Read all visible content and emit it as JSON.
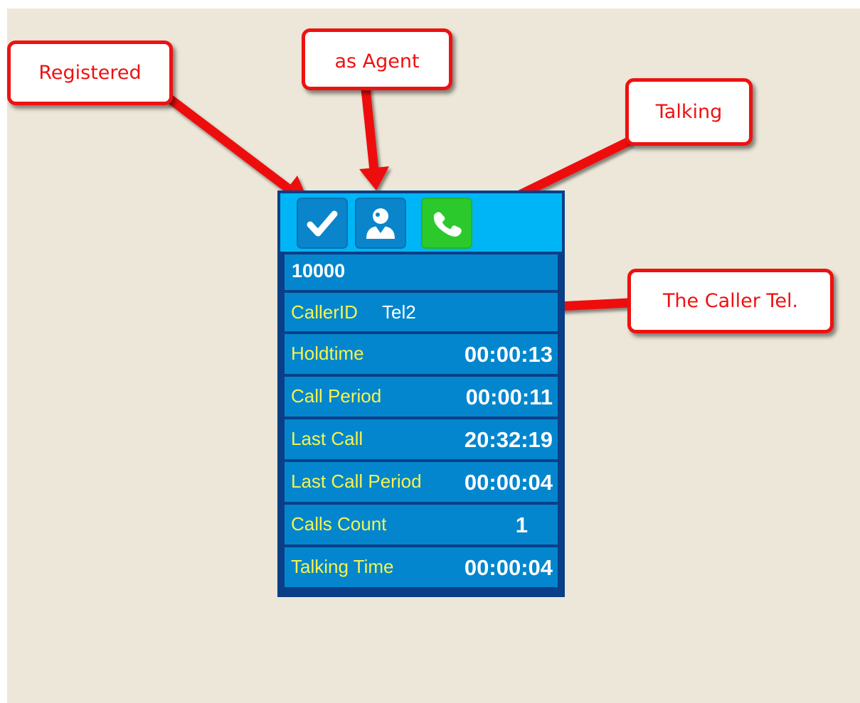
{
  "annotations": {
    "registered": "Registered",
    "agent": "as Agent",
    "talking": "Talking",
    "caller": "The Caller Tel."
  },
  "panel": {
    "icons": [
      "check-icon",
      "agent-user-icon",
      "phone-talking-icon"
    ],
    "extension": "10000",
    "caller_id": {
      "label": "CallerID",
      "value": "Tel2"
    },
    "stats": [
      {
        "label": "Holdtime",
        "value": "00:00:13"
      },
      {
        "label": "Call Period",
        "value": "00:00:11"
      },
      {
        "label": "Last Call",
        "value": "20:32:19"
      },
      {
        "label": "Last Call Period",
        "value": "00:00:04"
      },
      {
        "label": "Calls Count",
        "value": "1"
      },
      {
        "label": "Talking Time",
        "value": "00:00:04"
      }
    ]
  },
  "colors": {
    "annotation_red": "#ee1111",
    "label_yellow": "#f7f34d",
    "row_blue": "#0386ce",
    "icon_bar_cyan": "#00b5f5",
    "talking_green": "#2bc92b"
  }
}
